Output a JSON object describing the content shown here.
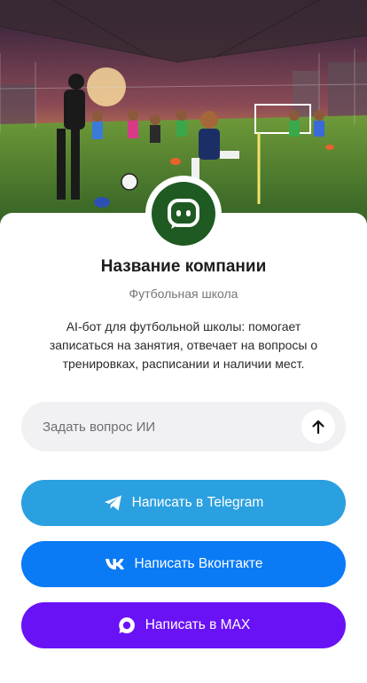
{
  "hero": {
    "image_description": "photo-banner",
    "colors": {
      "sky_top": "#2a1e3a",
      "sky_glow": "#f3a24b",
      "field": "#3f7a2a"
    }
  },
  "company": {
    "name": "Название компании",
    "category": "Футбольная школа"
  },
  "description": "AI-бот для футбольной школы: помогает записаться на занятия, отвечает на вопросы о тренировках, расписании и наличии мест.",
  "ask": {
    "placeholder": "Задать вопрос ИИ",
    "value": ""
  },
  "buttons": {
    "telegram": {
      "label": "Написать в Telegram",
      "color": "#2aa0e0",
      "icon": "telegram-icon"
    },
    "vk": {
      "label": "Написать Вконтакте",
      "color": "#0a7af5",
      "icon": "vk-icon"
    },
    "max": {
      "label": "Написать в MAX",
      "color": "#6a12f6",
      "icon": "max-icon"
    }
  },
  "colors": {
    "logo_bg": "#1f5a22",
    "ask_bg": "#f1f1f3"
  }
}
